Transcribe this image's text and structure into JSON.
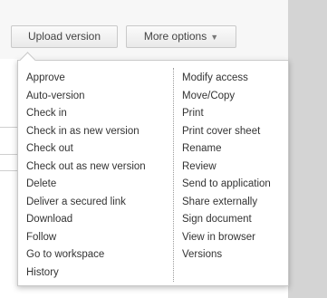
{
  "toolbar": {
    "upload_label": "Upload version",
    "more_label": "More options"
  },
  "icons": {
    "more_caret": "chevron-down-icon"
  },
  "colors": {
    "right_panel": "#d4d4d4",
    "menu_border": "#c8c8c8",
    "text": "#333333"
  },
  "menu": {
    "left": [
      "Approve",
      "Auto-version",
      "Check in",
      "Check in as new version",
      "Check out",
      "Check out as new version",
      "Delete",
      "Deliver a secured link",
      "Download",
      "Follow",
      "Go to workspace",
      "History"
    ],
    "right": [
      "Modify access",
      "Move/Copy",
      "Print",
      "Print cover sheet",
      "Rename",
      "Review",
      "Send to application",
      "Share externally",
      "Sign document",
      "View in browser",
      "Versions"
    ]
  }
}
